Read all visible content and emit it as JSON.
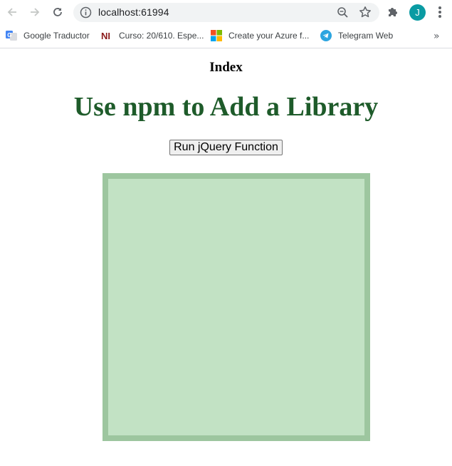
{
  "browser": {
    "url": "localhost:61994",
    "avatar_letter": "J",
    "bookmarks": [
      {
        "label": "Google Traductor",
        "icon": "google-translate-icon"
      },
      {
        "label": "Curso: 20/610. Espe...",
        "icon": "ni-icon"
      },
      {
        "label": "Create your Azure f...",
        "icon": "microsoft-icon"
      },
      {
        "label": "Telegram Web",
        "icon": "telegram-icon"
      }
    ],
    "more_label": "»"
  },
  "page": {
    "title": "Index",
    "heading": "Use npm to Add a Library",
    "button_label": "Run jQuery Function",
    "colors": {
      "heading": "#1e5b2a",
      "box_fill": "#c2e2c4",
      "box_border": "#9dc69f"
    }
  }
}
